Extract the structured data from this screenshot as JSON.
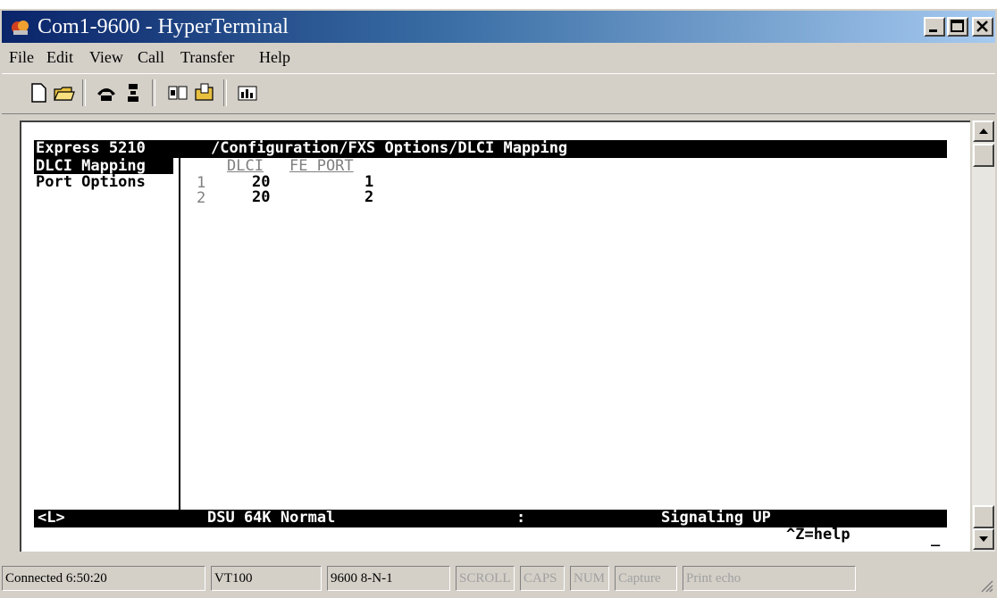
{
  "window": {
    "title": "Com1-9600 - HyperTerminal"
  },
  "menu": [
    "File",
    "Edit",
    "View",
    "Call",
    "Transfer",
    "Help"
  ],
  "toolbar_icons": [
    "new-icon",
    "open-icon",
    "phone-connect-icon",
    "phone-disconnect-icon",
    "send-icon",
    "receive-icon",
    "properties-icon"
  ],
  "terminal": {
    "header_product": "Express 5210",
    "header_path": "/Configuration/FXS Options/DLCI Mapping",
    "menu_items": [
      "DLCI Mapping",
      "Port Options"
    ],
    "table": {
      "columns": [
        "DLCI",
        "FE PORT"
      ],
      "rows": [
        {
          "index": "1",
          "dlci": "20",
          "fe_port": "1"
        },
        {
          "index": "2",
          "dlci": "20",
          "fe_port": "2"
        }
      ]
    },
    "status_left": "<L>",
    "status_mode": "DSU 64K Normal",
    "status_sep": ":",
    "status_signal": "Signaling UP",
    "help_hint": "^Z=help",
    "cursor": "_"
  },
  "statusbar": {
    "connected": "Connected 6:50:20",
    "emulation": "VT100",
    "settings": "9600 8-N-1",
    "scroll": "SCROLL",
    "caps": "CAPS",
    "num": "NUM",
    "capture": "Capture",
    "print_echo": "Print echo"
  }
}
